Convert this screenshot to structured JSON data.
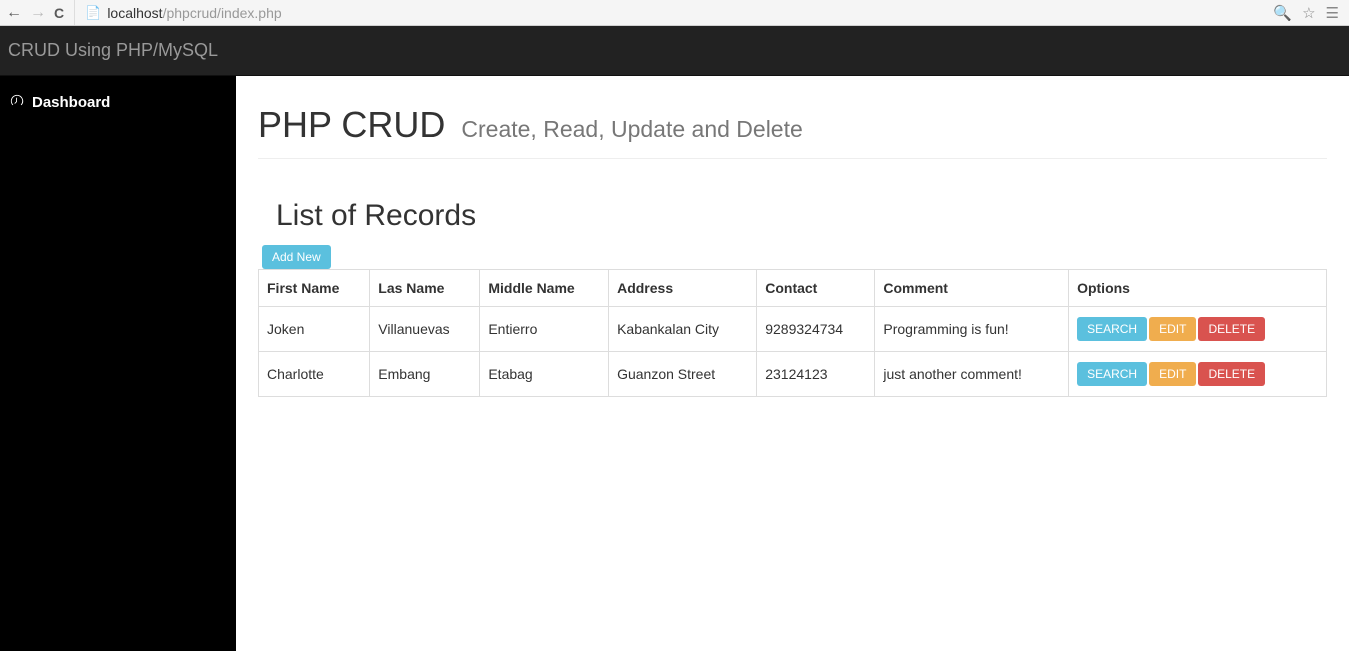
{
  "browser": {
    "url_host": "localhost",
    "url_path": "/phpcrud/index.php"
  },
  "header": {
    "title": "CRUD Using PHP/MySQL"
  },
  "sidebar": {
    "dashboard_label": "Dashboard"
  },
  "main": {
    "title": "PHP CRUD",
    "subtitle": "Create, Read, Update and Delete",
    "section_title": "List of Records",
    "add_new_label": "Add New",
    "columns": {
      "first_name": "First Name",
      "last_name": "Las Name",
      "middle_name": "Middle Name",
      "address": "Address",
      "contact": "Contact",
      "comment": "Comment",
      "options": "Options"
    },
    "rows": [
      {
        "first_name": "Joken",
        "last_name": "Villanuevas",
        "middle_name": "Entierro",
        "address": "Kabankalan City",
        "contact": "9289324734",
        "comment": "Programming is fun!"
      },
      {
        "first_name": "Charlotte",
        "last_name": "Embang",
        "middle_name": "Etabag",
        "address": "Guanzon Street",
        "contact": "23124123",
        "comment": "just another comment!"
      }
    ],
    "buttons": {
      "search": "SEARCH",
      "edit": "EDIT",
      "delete": "DELETE"
    }
  }
}
